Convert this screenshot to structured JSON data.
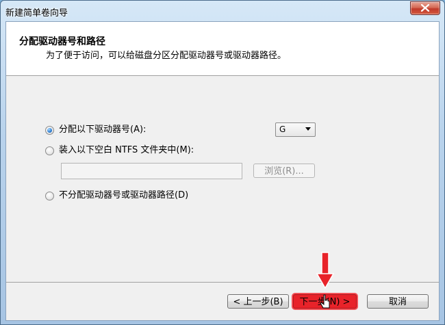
{
  "window": {
    "title": "新建简单卷向导"
  },
  "header": {
    "title": "分配驱动器号和路径",
    "subtitle": "为了便于访问，可以给磁盘分区分配驱动器号或驱动器路径。"
  },
  "options": {
    "assign_letter": {
      "label": "分配以下驱动器号(A):",
      "checked": true
    },
    "mount_folder": {
      "label": "装入以下空白 NTFS 文件夹中(M):",
      "checked": false
    },
    "no_assign": {
      "label": "不分配驱动器号或驱动器路径(D)",
      "checked": false
    }
  },
  "drive_select": {
    "value": "G"
  },
  "folder_path": {
    "value": ""
  },
  "browse_button": {
    "label": "浏览(R)..."
  },
  "footer": {
    "back_label": "< 上一步(B)",
    "next_label": "下一步(N) >",
    "cancel_label": "取消"
  },
  "colors": {
    "highlight": "#e8232a",
    "radio_selected": "#2f7fd1"
  }
}
